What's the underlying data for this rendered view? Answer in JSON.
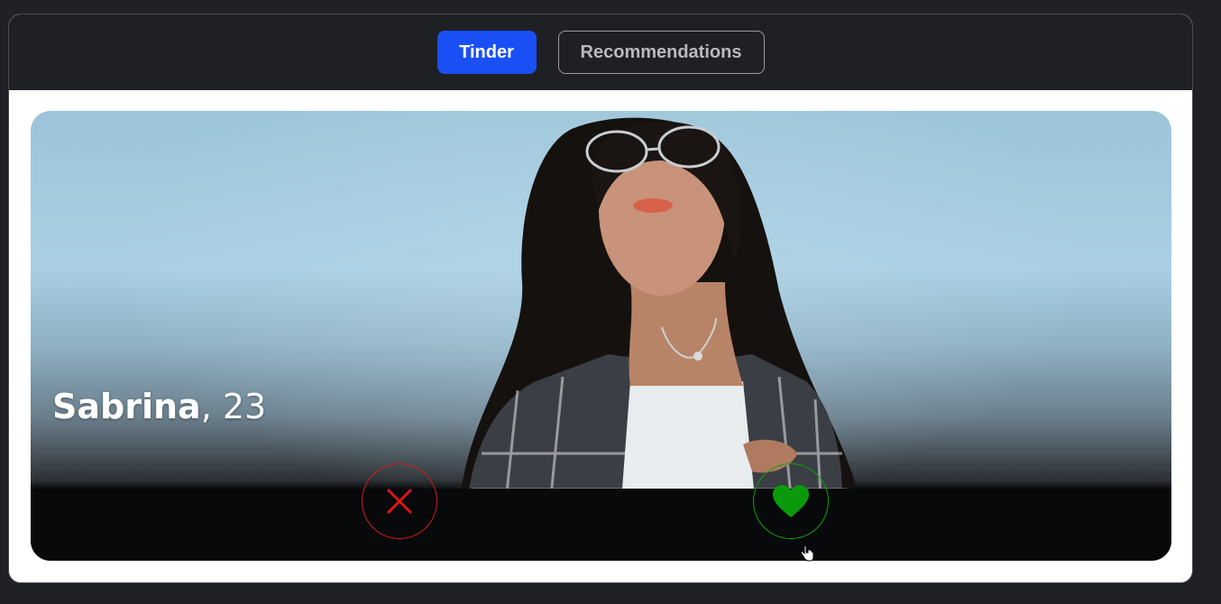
{
  "nav": {
    "tabs": [
      {
        "label": "Tinder",
        "active": true
      },
      {
        "label": "Recommendations",
        "active": false
      }
    ],
    "active_color": "#1a4ff5"
  },
  "profile": {
    "name": "Sabrina",
    "age_text": ", 23",
    "photo": "woman-in-glasses-plaid-shirt"
  },
  "actions": {
    "nope_icon": "close-x-icon",
    "nope_color": "#d21a1a",
    "like_icon": "heart-icon",
    "like_color": "#0fa00f"
  }
}
